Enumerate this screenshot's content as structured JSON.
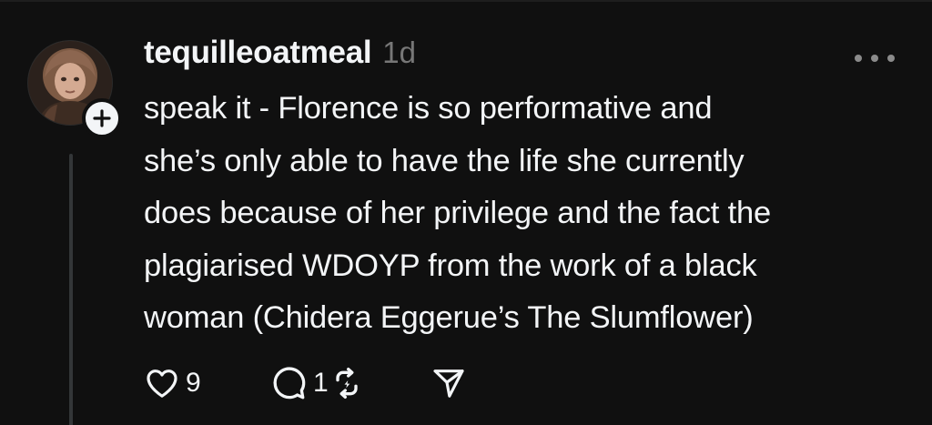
{
  "post": {
    "username": "tequilleoatmeal",
    "timestamp": "1d",
    "text_lines": [
      "speak it - Florence is so performative and",
      "she’s only able to have the life she currently",
      "does because of her privilege and the fact the",
      "plagiarised WDOYP from the work of a black",
      "woman (Chidera Eggerue’s The Slumflower)"
    ],
    "actions": {
      "likes": "9",
      "replies": "1"
    }
  },
  "icons": {
    "follow": "plus-icon",
    "more": "more-horizontal-icon",
    "like": "heart-icon",
    "reply": "comment-icon",
    "repost": "repost-icon",
    "share": "send-icon"
  },
  "colors": {
    "background": "#101010",
    "text": "#f3f5f7",
    "muted": "#777777",
    "thread_line": "#333638"
  }
}
